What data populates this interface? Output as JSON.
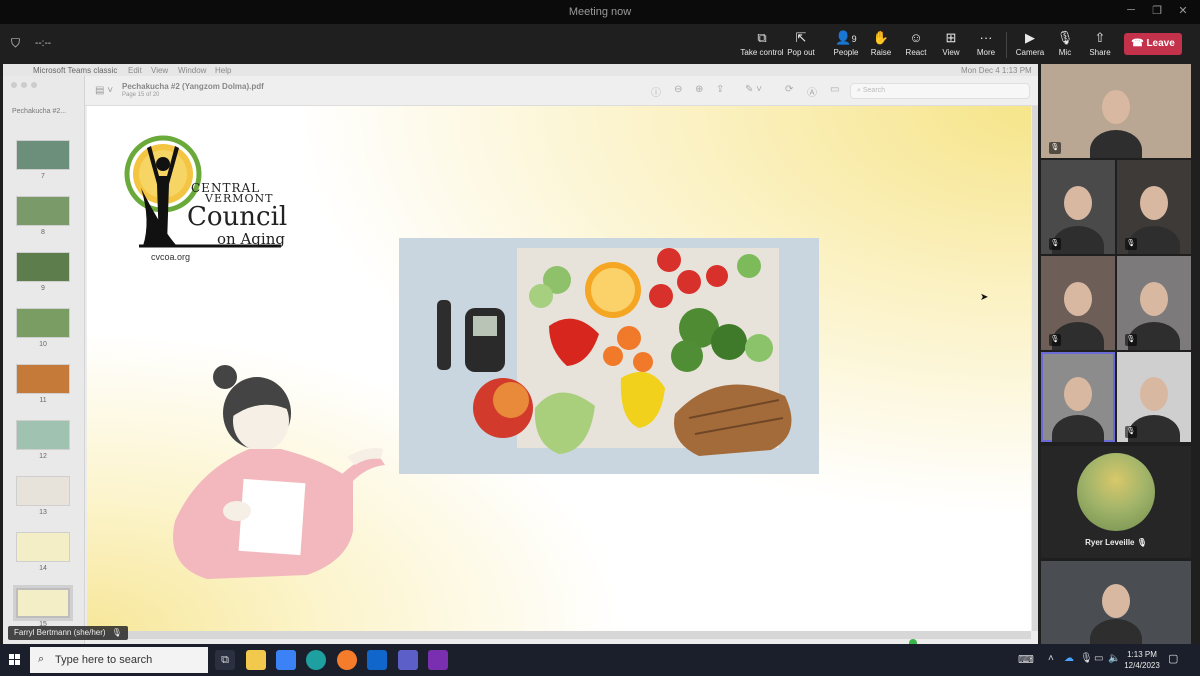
{
  "window": {
    "title": "Meeting now",
    "controls": [
      "minimize",
      "restore",
      "close"
    ]
  },
  "meeting_bar": {
    "shield_icon": "shield-icon",
    "timer": "--:--",
    "buttons": [
      {
        "id": "take-control",
        "label": "Take control",
        "icon": "take-control-icon"
      },
      {
        "id": "pop-out",
        "label": "Pop out",
        "icon": "pop-out-icon"
      },
      {
        "id": "people",
        "label": "People",
        "icon": "people-icon",
        "count": "9"
      },
      {
        "id": "raise",
        "label": "Raise",
        "icon": "hand-icon"
      },
      {
        "id": "react",
        "label": "React",
        "icon": "smile-icon"
      },
      {
        "id": "view",
        "label": "View",
        "icon": "grid-icon"
      },
      {
        "id": "more",
        "label": "More",
        "icon": "more-icon"
      },
      {
        "id": "camera",
        "label": "Camera",
        "icon": "camera-icon"
      },
      {
        "id": "mic",
        "label": "Mic",
        "icon": "mic-off-icon"
      },
      {
        "id": "share",
        "label": "Share",
        "icon": "share-icon"
      }
    ],
    "leave_label": "Leave"
  },
  "mac": {
    "menu": [
      "Microsoft Teams classic",
      "Edit",
      "View",
      "Window",
      "Help"
    ],
    "clock": "Mon Dec 4  1:13 PM",
    "doc_title": "Pechakucha #2 (Yangzom Dolma).pdf",
    "page_info": "Page 15 of 20",
    "search_placeholder": "Search",
    "sidebar_title": "Pechakucha #2...",
    "thumbs": [
      "7",
      "8",
      "9",
      "10",
      "11",
      "12",
      "13",
      "14",
      "15"
    ],
    "selected_thumb": "15"
  },
  "slide": {
    "logo": {
      "line1": "CENTRAL",
      "line2": "VERMONT",
      "line3": "Council",
      "line4": "on Aging",
      "url": "cvcoa.org"
    },
    "photo_alt_items": [
      "glucose-meter",
      "vegetables",
      "bread",
      "fruit"
    ]
  },
  "presenter_label": "Farryl Bertmann (she/her)",
  "participants": [
    {
      "name": "",
      "muted": true
    },
    {
      "name": "",
      "muted": true
    },
    {
      "name": "",
      "muted": true
    },
    {
      "name": "",
      "muted": true
    },
    {
      "name": "",
      "muted": true
    },
    {
      "name": "",
      "muted": false,
      "active": true
    },
    {
      "name": "",
      "muted": true
    },
    {
      "name": "Ryer Leveille",
      "muted": true
    },
    {
      "name": "",
      "muted": false
    }
  ],
  "taskbar": {
    "search_placeholder": "Type here to search",
    "time": "1:13 PM",
    "date": "12/4/2023"
  },
  "colors": {
    "leave": "#c4314b",
    "taskbar": "#1a1f2b",
    "accent_border": "#6b6bd6"
  }
}
